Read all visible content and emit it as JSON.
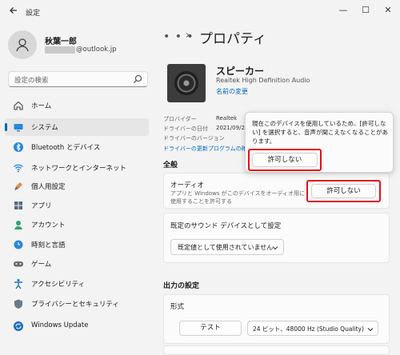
{
  "app": {
    "title": "設定",
    "back_icon": "arrow-left-icon"
  },
  "window_controls": {
    "minimize": "—",
    "maximize": "☐",
    "close": "✕"
  },
  "user": {
    "name": "秋葉一郎",
    "email": "@outlook.jp"
  },
  "search": {
    "placeholder": "設定の検索"
  },
  "nav": [
    {
      "label": "ホーム",
      "icon": "home-icon",
      "selected": false
    },
    {
      "label": "システム",
      "icon": "system-icon",
      "selected": true
    },
    {
      "label": "Bluetooth とデバイス",
      "icon": "bluetooth-icon",
      "selected": false
    },
    {
      "label": "ネットワークとインターネット",
      "icon": "wifi-icon",
      "selected": false
    },
    {
      "label": "個人用設定",
      "icon": "brush-icon",
      "selected": false
    },
    {
      "label": "アプリ",
      "icon": "apps-icon",
      "selected": false
    },
    {
      "label": "アカウント",
      "icon": "account-icon",
      "selected": false
    },
    {
      "label": "時刻と言語",
      "icon": "globe-clock-icon",
      "selected": false
    },
    {
      "label": "ゲーム",
      "icon": "gamepad-icon",
      "selected": false
    },
    {
      "label": "アクセシビリティ",
      "icon": "accessibility-icon",
      "selected": false
    },
    {
      "label": "プライバシーとセキュリティ",
      "icon": "shield-icon",
      "selected": false
    },
    {
      "label": "Windows Update",
      "icon": "update-icon",
      "selected": false
    }
  ],
  "breadcrumb": {
    "ellipsis": "• • •",
    "chevron": "›",
    "title": "プロパティ"
  },
  "device": {
    "name": "スピーカー",
    "subtitle": "Realtek High Definition Audio",
    "rename_link": "名前の変更",
    "props": [
      {
        "key": "プロバイダー",
        "value": "Realtek"
      },
      {
        "key": "ドライバーの日付",
        "value": "2021/09/2"
      },
      {
        "key": "ドライバーのバージョン",
        "value": ""
      }
    ],
    "driver_update_link": "ドライバーの更新プログラムの確認"
  },
  "popup": {
    "text": "現在このデバイスを使用しているため、[許可しない] を選択すると、音声が聞こえなくなることがあります。",
    "button": "許可しない"
  },
  "general": {
    "heading": "全般",
    "audio_title": "オーディオ",
    "audio_desc": "アプリと Windows がこのデバイスをオーディオ用に使用することを許可する",
    "audio_button": "許可しない",
    "default_title": "既定のサウンド デバイスとして設定",
    "default_dropdown": "既定値として使用されていません"
  },
  "output": {
    "heading": "出力の設定",
    "format_title": "形式",
    "test_button": "テスト",
    "format_value": "24 ビット、48000 Hz (Studio Quality)"
  },
  "colors": {
    "accent": "#0067c0",
    "highlight": "#e3101a"
  }
}
